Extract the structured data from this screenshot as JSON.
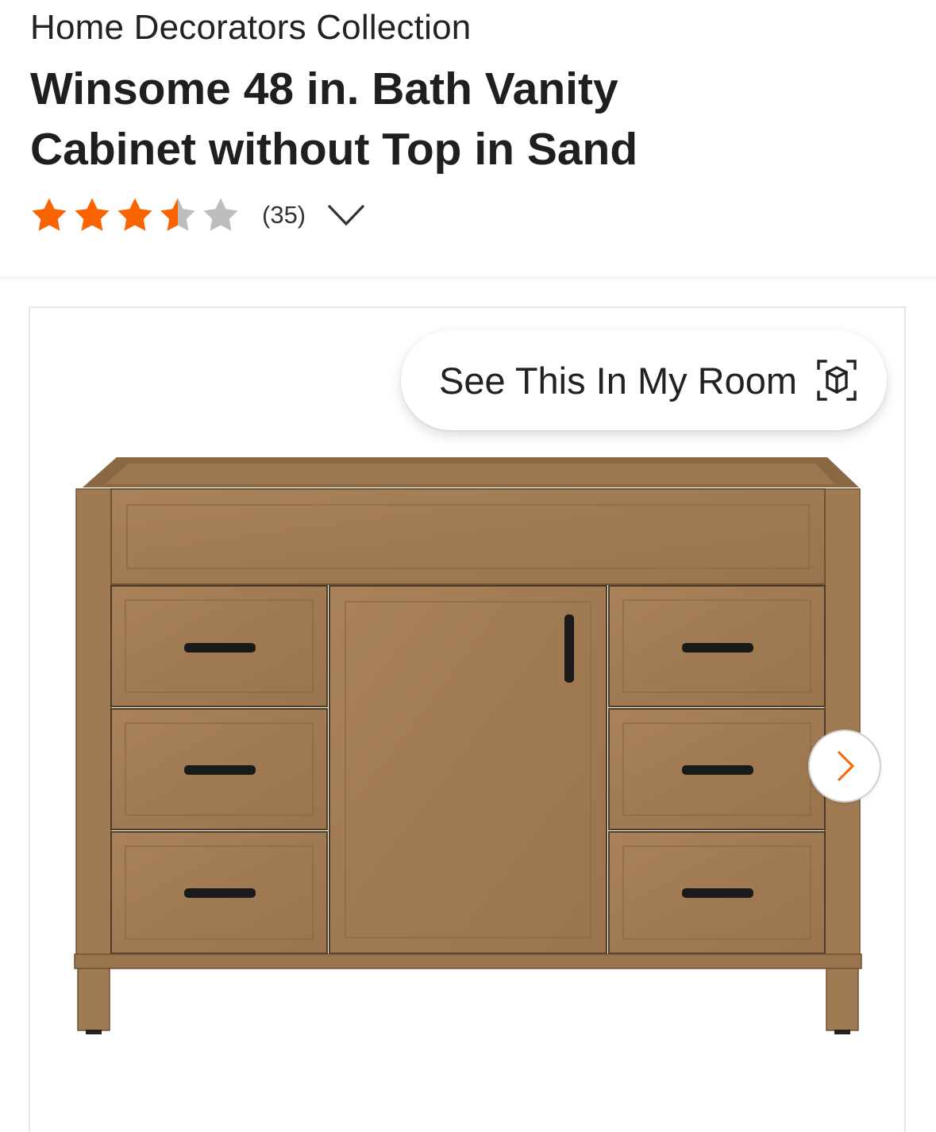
{
  "product": {
    "brand": "Home Decorators Collection",
    "title": "Winsome 48 in. Bath Vanity Cabinet without Top in Sand"
  },
  "rating": {
    "value": 3.5,
    "max": 5,
    "review_count_label": "(35)",
    "star_color": "#f96302",
    "empty_star_color": "#bdbdbd"
  },
  "media": {
    "see_in_room_label": "See This In My Room",
    "see_in_room_icon": "ar-cube-icon",
    "next_icon": "chevron-right-icon",
    "accent_color": "#f96302"
  }
}
